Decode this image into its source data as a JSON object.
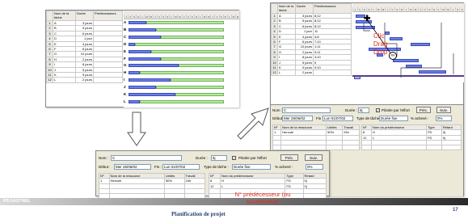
{
  "colors": {
    "red_annotation": "#e0281a",
    "bar_blue": "#6c7ee6",
    "slack_green": "#b9e6a3",
    "footer_text": "#2a3f7a"
  },
  "left_window": {
    "headers": [
      "",
      "Nom de la tâche",
      "Durée",
      "Prédécesseurs"
    ],
    "rows": [
      {
        "n": "1",
        "name": "A",
        "dur": "3 jours",
        "pred": ""
      },
      {
        "n": "2",
        "name": "B",
        "dur": "5 jours",
        "pred": ""
      },
      {
        "n": "3",
        "name": "C",
        "dur": "6 jours",
        "pred": ""
      },
      {
        "n": "4",
        "name": "D",
        "dur": "1 jour",
        "pred": ""
      },
      {
        "n": "5",
        "name": "E",
        "dur": "4 jours",
        "pred": ""
      },
      {
        "n": "6",
        "name": "F",
        "dur": "6 jours",
        "pred": ""
      },
      {
        "n": "7",
        "name": "G",
        "dur": "10 jours",
        "pred": ""
      },
      {
        "n": "8",
        "name": "H",
        "dur": "2 jours",
        "pred": ""
      },
      {
        "n": "9",
        "name": "I",
        "dur": "8 jours",
        "pred": ""
      },
      {
        "n": "10",
        "name": "J",
        "dur": "5 jours",
        "pred": ""
      },
      {
        "n": "11",
        "name": "K",
        "dur": "9 jours",
        "pred": ""
      },
      {
        "n": "12",
        "name": "L",
        "dur": "2 jours",
        "pred": ""
      }
    ],
    "gantt_days": [
      "J",
      "V",
      "S",
      "D",
      "L",
      "M",
      "M",
      "J",
      "V",
      "S",
      "D",
      "L",
      "M",
      "M",
      "J",
      "V",
      "S",
      "D",
      "L",
      "M",
      "M",
      "J",
      "V",
      "S",
      "D",
      "L",
      "M",
      "M"
    ],
    "bar_labels": [
      "A",
      "B",
      "C",
      "D",
      "E",
      "F",
      "G",
      "H",
      "I",
      "J",
      "K",
      "L"
    ]
  },
  "right_window": {
    "headers": [
      "",
      "Nom de la tâche",
      "Durée",
      "Prédécesseurs"
    ],
    "rows": [
      {
        "n": "1",
        "name": "A",
        "dur": "3 jours",
        "pred": "8;12"
      },
      {
        "n": "2",
        "name": "B",
        "dur": "5 jours",
        "pred": "8;12"
      },
      {
        "n": "3",
        "name": "C",
        "dur": "6 jours",
        "pred": "8;12"
      },
      {
        "n": "4",
        "name": "D",
        "dur": "1 jour",
        "pred": "11"
      },
      {
        "n": "5",
        "name": "E",
        "dur": "4 jours",
        "pred": "4;8"
      },
      {
        "n": "6",
        "name": "F",
        "dur": "6 jours",
        "pred": "7;10"
      },
      {
        "n": "7",
        "name": "G",
        "dur": "10 jours",
        "pred": "1;11"
      },
      {
        "n": "8",
        "name": "H",
        "dur": "2 jours",
        "pred": "9;11"
      },
      {
        "n": "9",
        "name": "I",
        "dur": "8 jours",
        "pred": "4;10"
      },
      {
        "n": "10",
        "name": "J",
        "dur": "5 jours",
        "pred": "5"
      },
      {
        "n": "11",
        "name": "K",
        "dur": "9 jours",
        "pred": "9;10"
      },
      {
        "n": "12",
        "name": "L",
        "dur": "2 jours",
        "pred": ""
      }
    ],
    "annotation": [
      "Clic",
      "Drag",
      "Drop"
    ],
    "form": {
      "nom_label": "Nom :",
      "nom_value": "C",
      "duree_label": "Durée :",
      "duree_value": "6j",
      "pilotee_label": "Pilotée par l'effort",
      "prec_btn": "Préc.",
      "suiv_btn": "Suiv.",
      "debut_label": "Début :",
      "debut_value": "Mer 26/06/02",
      "fin_label": "Fin :",
      "fin_value": "Lun 01/07/02",
      "type_label": "Type de tâche :",
      "type_value": "Durée fixe",
      "achev_label": "% achevé :",
      "achev_value": "0%",
      "res_headers": [
        "Nº",
        "Nom de la ressource",
        "Unités",
        "Travail"
      ],
      "res_rows": [
        [
          "1",
          "Hercule",
          "50%",
          "24h"
        ]
      ],
      "pred_headers": [
        "Nº",
        "Nom du prédécesseur",
        "Type",
        "Retard"
      ],
      "pred_rows": [
        [
          "8",
          "H",
          "FD",
          "0j"
        ],
        [
          "12",
          "L",
          "FD",
          "0j"
        ]
      ]
    }
  },
  "bottom_window": {
    "nom_label": "Nom :",
    "nom_value": "C",
    "duree_label": "Durée :",
    "duree_value": "6j",
    "pilotee_label": "Pilotée par l'effort",
    "prec_btn": "Préc.",
    "suiv_btn": "Suiv.",
    "debut_label": "Début :",
    "debut_value": "Mer 26/06/02",
    "fin_label": "Fin :",
    "fin_value": "Lun 01/07/02",
    "type_label": "Type de tâche :",
    "type_value": "Durée fixe",
    "achev_label": "% achevé :",
    "achev_value": "0%",
    "res_headers": [
      "Nº",
      "Nom de la ressource",
      "Unités",
      "Travail"
    ],
    "res_rows": [
      [
        "1",
        "Hercule",
        "50%",
        "24h"
      ]
    ],
    "pred_headers": [
      "Nº",
      "Nom du prédécesseur",
      "Type",
      "Retard"
    ],
    "pred_rows": [
      [
        "8",
        "H",
        "FD",
        "0j"
      ],
      [
        "12",
        "L",
        "FD",
        "0j"
      ]
    ],
    "annotation_line1": "N° prédécesseur (ou",
    "annotation_line2": "successeur)"
  },
  "footer": {
    "author": "PB GASTINEL",
    "title": "Planification de projet",
    "page": "17"
  }
}
